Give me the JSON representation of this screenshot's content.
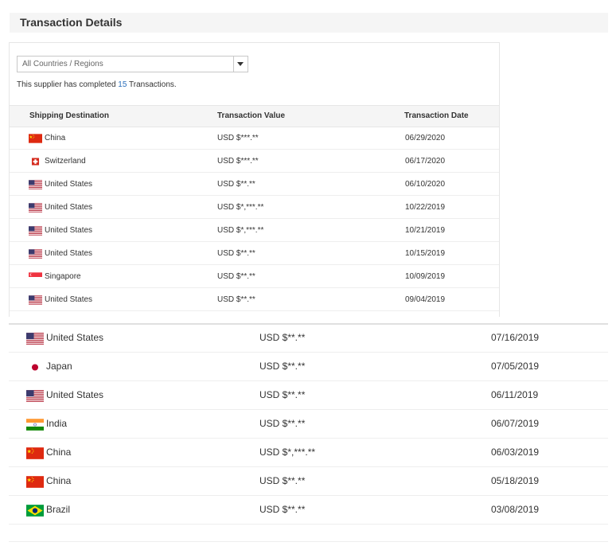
{
  "header": {
    "title": "Transaction Details"
  },
  "filter": {
    "selected": "All Countries / Regions"
  },
  "summary": {
    "prefix": "This supplier has completed ",
    "count": "15",
    "suffix": " Transactions."
  },
  "columns": {
    "destination": "Shipping Destination",
    "value": "Transaction Value",
    "date": "Transaction Date"
  },
  "transactions": [
    {
      "country": "China",
      "flag": "china-flag",
      "value": "USD $***.**",
      "date": "06/29/2020"
    },
    {
      "country": "Switzerland",
      "flag": "switzerland-flag",
      "value": "USD $***.**",
      "date": "06/17/2020"
    },
    {
      "country": "United States",
      "flag": "united-states-flag",
      "value": "USD $**.**",
      "date": "06/10/2020"
    },
    {
      "country": "United States",
      "flag": "united-states-flag",
      "value": "USD $*,***.**",
      "date": "10/22/2019"
    },
    {
      "country": "United States",
      "flag": "united-states-flag",
      "value": "USD $*,***.**",
      "date": "10/21/2019"
    },
    {
      "country": "United States",
      "flag": "united-states-flag",
      "value": "USD $**.**",
      "date": "10/15/2019"
    },
    {
      "country": "Singapore",
      "flag": "singapore-flag",
      "value": "USD $**.**",
      "date": "10/09/2019"
    },
    {
      "country": "United States",
      "flag": "united-states-flag",
      "value": "USD $**.**",
      "date": "09/04/2019"
    }
  ],
  "transactions_more": [
    {
      "country": "United States",
      "flag": "united-states-flag",
      "value": "USD $**.**",
      "date": "07/16/2019"
    },
    {
      "country": "Japan",
      "flag": "japan-flag",
      "value": "USD $**.**",
      "date": "07/05/2019"
    },
    {
      "country": "United States",
      "flag": "united-states-flag",
      "value": "USD $**.**",
      "date": "06/11/2019"
    },
    {
      "country": "India",
      "flag": "india-flag",
      "value": "USD $**.**",
      "date": "06/07/2019"
    },
    {
      "country": "China",
      "flag": "china-flag",
      "value": "USD $*,***.**",
      "date": "06/03/2019"
    },
    {
      "country": "China",
      "flag": "china-flag",
      "value": "USD $**.**",
      "date": "05/18/2019"
    },
    {
      "country": "Brazil",
      "flag": "brazil-flag",
      "value": "USD $**.**",
      "date": "03/08/2019"
    }
  ]
}
